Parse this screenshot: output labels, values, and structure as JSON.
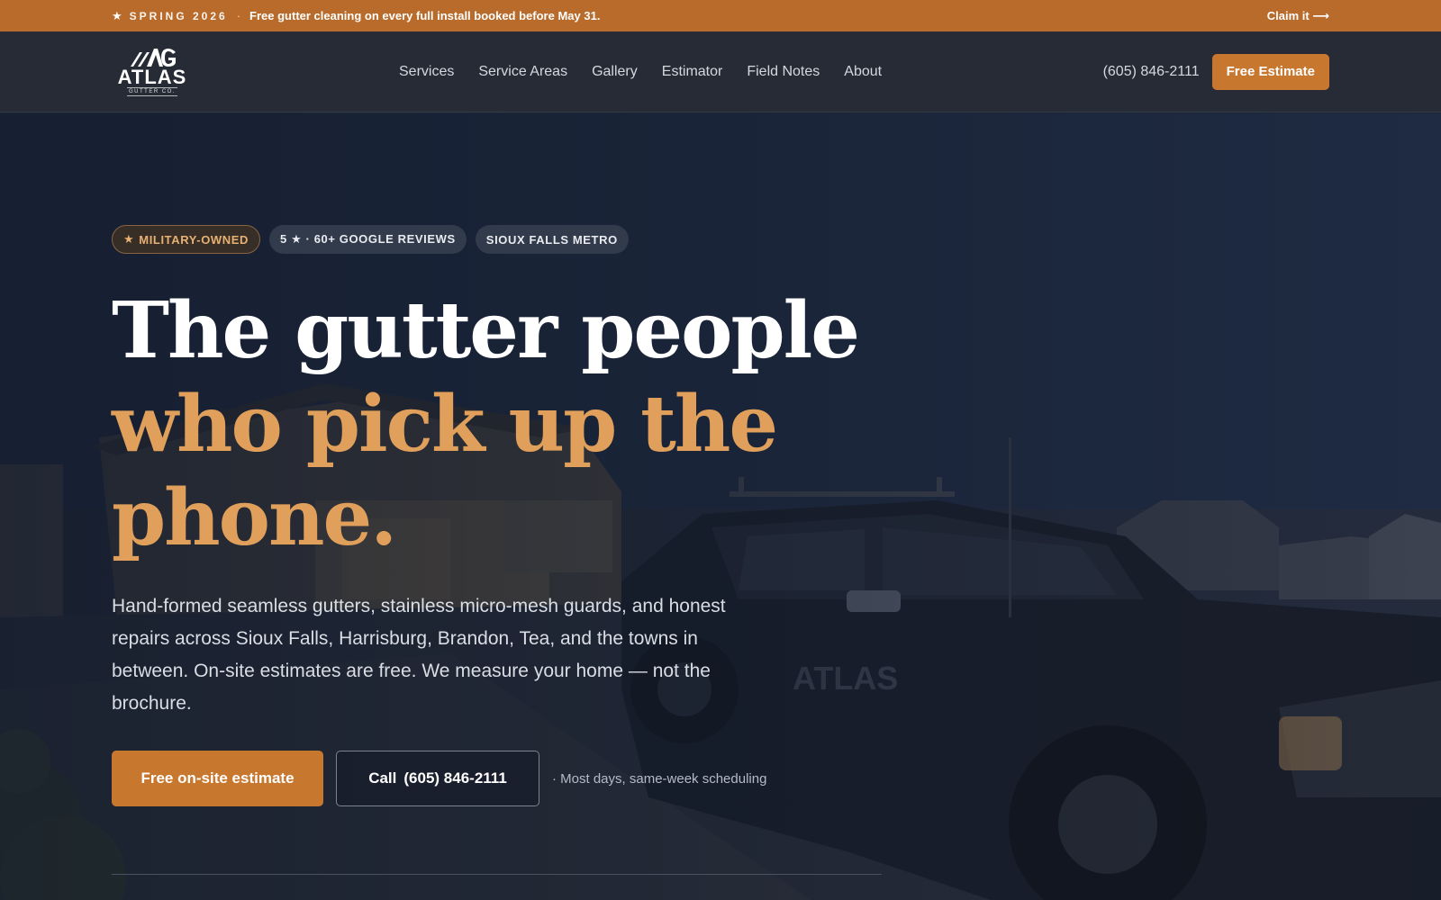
{
  "promo": {
    "star_icon": "star-icon",
    "season": "SPRING 2026",
    "separator": "·",
    "message": "Free gutter cleaning on every full install booked before May 31.",
    "claim_label": "Claim it",
    "claim_arrow": "⟶"
  },
  "header": {
    "logo_word": "ATLAS",
    "logo_sub": "GUTTER CO.",
    "nav": [
      "Services",
      "Service Areas",
      "Gallery",
      "Estimator",
      "Field Notes",
      "About"
    ],
    "phone": "(605) 846-2111",
    "cta_label": "Free Estimate"
  },
  "hero": {
    "badges": {
      "military": "MILITARY-OWNED",
      "reviews": "5 ★ · 60+ GOOGLE REVIEWS",
      "area": "SIOUX FALLS METRO"
    },
    "headline_white": "The gutter people",
    "headline_accent_1": "who pick up the",
    "headline_accent_2": "phone.",
    "lede": "Hand-formed seamless gutters, stainless micro-mesh guards, and honest repairs across Sioux Falls, Harrisburg, Brandon, Tea, and the towns in between. On-site estimates are free. We measure your home — not the brochure.",
    "primary_cta": "Free on-site estimate",
    "call_prefix": "Call",
    "call_number": "(605) 846-2111",
    "schedule_note": "· Most days, same-week scheduling"
  },
  "colors": {
    "accent": "#c8772e",
    "accent_text": "#e0a05b",
    "promo_bg": "#b86b2a",
    "header_bg": "#262b35"
  }
}
